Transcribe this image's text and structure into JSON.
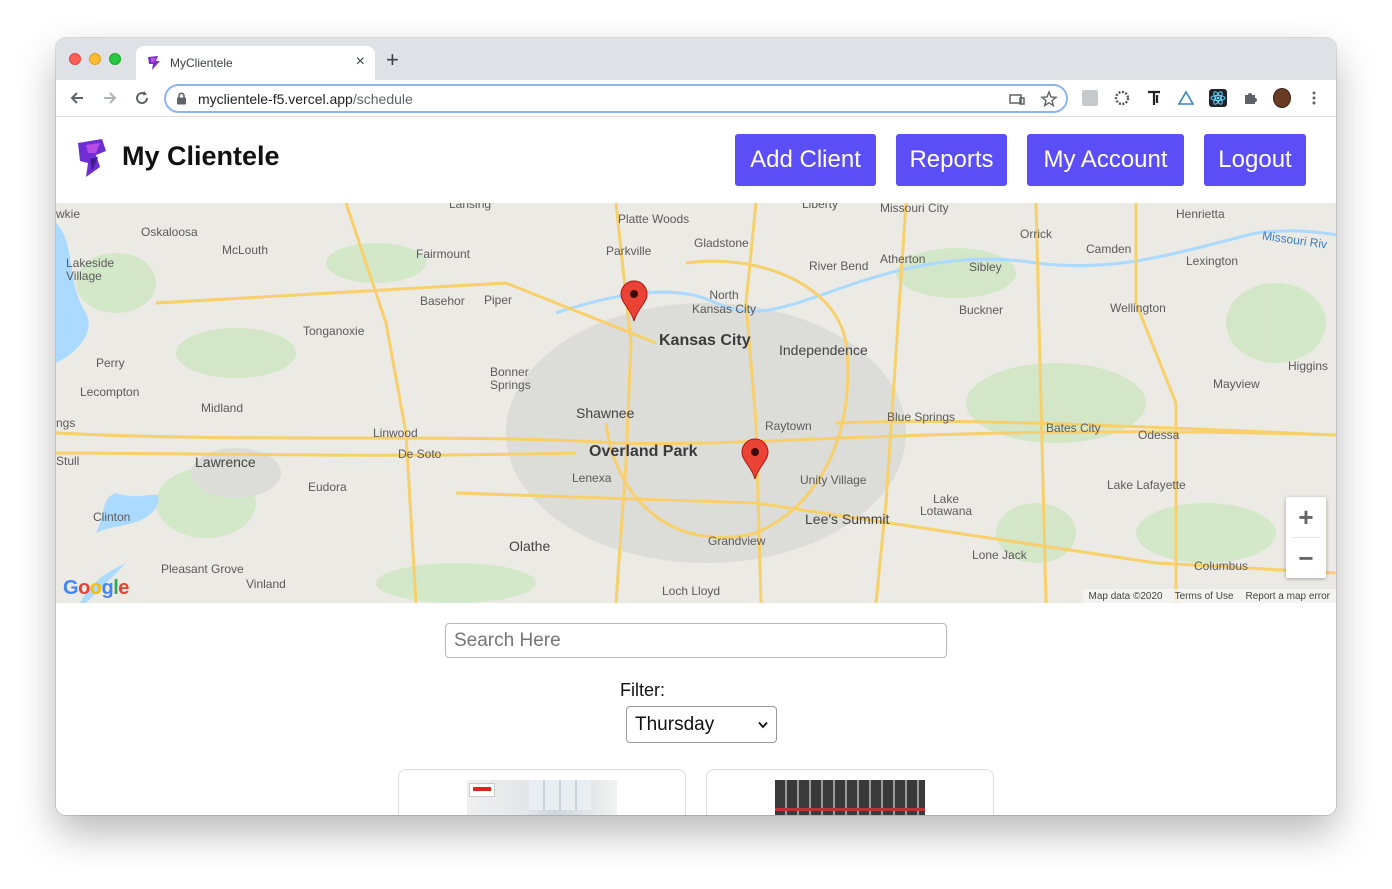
{
  "browser": {
    "tab_title": "MyClientele",
    "tab_close": "×",
    "new_tab": "+",
    "url_domain": "myclientele-f5.vercel.app",
    "url_path": "/schedule"
  },
  "header": {
    "brand": "My Clientele",
    "nav": [
      "Add Client",
      "Reports",
      "My Account",
      "Logout"
    ]
  },
  "map": {
    "labels": {
      "kansas_city": "Kansas City",
      "overland_park": "Overland Park",
      "independence": "Independence",
      "shawnee": "Shawnee",
      "olathe": "Olathe",
      "lawrence": "Lawrence",
      "lees_summit": "Lee's Summit",
      "blue_springs": "Blue Springs",
      "raytown": "Raytown",
      "north_kansas_city": "North\nKansas City",
      "gladstone": "Gladstone",
      "liberty": "Liberty",
      "platte_woods": "Platte Woods",
      "parkville": "Parkville",
      "fairmount": "Fairmount",
      "basehor": "Basehor",
      "piper": "Piper",
      "bonner_springs": "Bonner\nSprings",
      "lenexa": "Lenexa",
      "grandview": "Grandview",
      "unity_village": "Unity Village",
      "de_soto": "De Soto",
      "eudora": "Eudora",
      "linwood": "Linwood",
      "tonganoxie": "Tonganoxie",
      "mclouth": "McLouth",
      "oskaloosa": "Oskaloosa",
      "lakeside_village": "Lakeside\nVillage",
      "perry": "Perry",
      "lecompton": "Lecompton",
      "midland": "Midland",
      "clinton": "Clinton",
      "pleasant_grove": "Pleasant Grove",
      "vinland": "Vinland",
      "loch_lloyd": "Loch Lloyd",
      "lake_lotawana": "Lake\nLotawana",
      "lone_jack": "Lone Jack",
      "lake_lafayette": "Lake Lafayette",
      "odessa": "Odessa",
      "bates_city": "Bates City",
      "columbus": "Columbus",
      "mayview": "Mayview",
      "higgins": "Higgins",
      "buckner": "Buckner",
      "wellington": "Wellington",
      "lexington": "Lexington",
      "camden": "Camden",
      "orrick": "Orrick",
      "henrietta": "Henrietta",
      "missouri_city": "Missouri City",
      "atherton": "Atherton",
      "sibley": "Sibley",
      "river_bend": "River Bend",
      "missouri_river": "Missouri Riv",
      "lansing": "Lansing",
      "stull": "Stull",
      "ngs": "ngs",
      "wkie": "wkie"
    },
    "google": "Google",
    "footer": [
      "Map data ©2020",
      "Terms of Use",
      "Report a map error"
    ],
    "zoom_in": "+",
    "zoom_out": "−"
  },
  "search": {
    "placeholder": "Search Here",
    "value": ""
  },
  "filter": {
    "label": "Filter:",
    "selected": "Thursday"
  },
  "colors": {
    "accent": "#5c4ef6",
    "marker": "#ea4335"
  }
}
